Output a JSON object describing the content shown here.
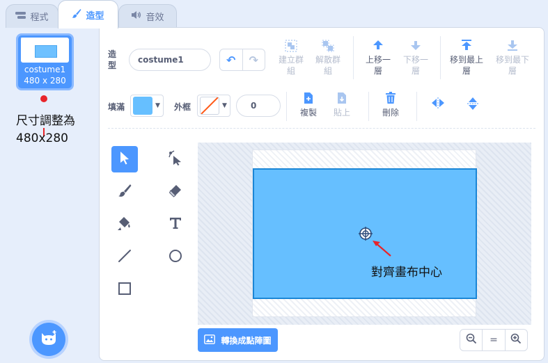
{
  "tabs": [
    {
      "label": "程式",
      "icon": "code-icon"
    },
    {
      "label": "造型",
      "icon": "brush-icon"
    },
    {
      "label": "音效",
      "icon": "speaker-icon"
    }
  ],
  "costume_list": {
    "item": {
      "index": "1",
      "name": "costume1",
      "size": "480 x 280"
    },
    "annotation": [
      "尺寸調整為",
      "480x280"
    ]
  },
  "toolbar": {
    "costume_label": "造型",
    "costume_name": "costume1",
    "group_label": [
      "建立群",
      "組"
    ],
    "ungroup_label": [
      "解散群",
      "組"
    ],
    "forward_label": [
      "上移一",
      "層"
    ],
    "backward_label": [
      "下移一",
      "層"
    ],
    "front_label": [
      "移到最上",
      "層"
    ],
    "back_label": [
      "移到最下",
      "層"
    ],
    "fill_label": "填滿",
    "outline_label": "外框",
    "outline_width": "0",
    "copy_label": "複製",
    "paste_label": "貼上",
    "delete_label": "刪除"
  },
  "colors": {
    "accent": "#4c97ff",
    "fill": "#66bfff",
    "rect_border": "#1b86d6",
    "annotation_red": "#e8242a"
  },
  "canvas": {
    "annotation": "對齊畫布中心"
  },
  "bottom": {
    "convert_label": "轉換成點陣圖",
    "zoom_out": "zoom-out-icon",
    "zoom_reset": "=",
    "zoom_in": "zoom-in-icon"
  }
}
